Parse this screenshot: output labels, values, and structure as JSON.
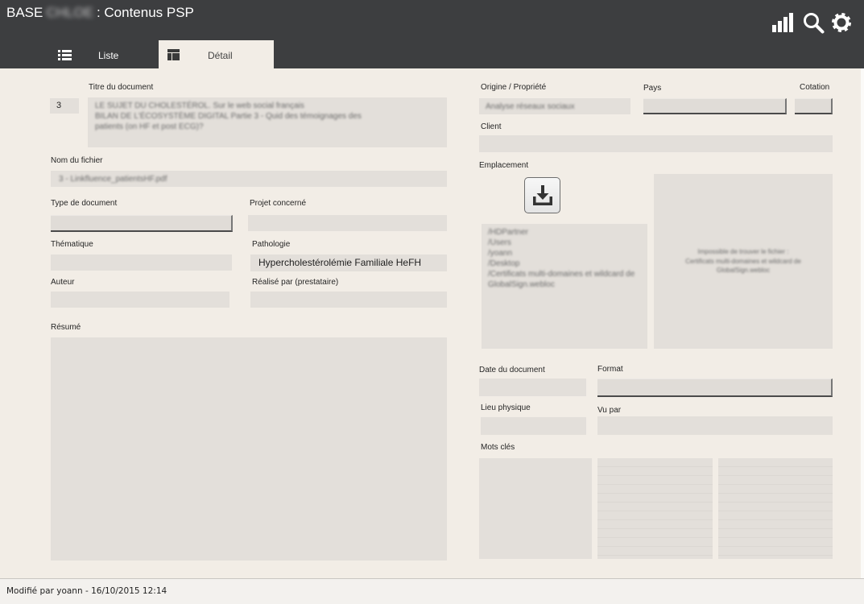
{
  "app": {
    "title_prefix": "BASE",
    "title_redacted": "CHLOE",
    "title_suffix": ": Contenus PSP"
  },
  "header": {
    "icons": [
      "bar-chart-icon",
      "search-icon",
      "gear-icon"
    ]
  },
  "tabs": [
    {
      "label": "Liste",
      "icon": "list-icon",
      "active": false
    },
    {
      "label": "Détail",
      "icon": "layout-icon",
      "active": true
    }
  ],
  "form": {
    "record_number": "3",
    "titre": {
      "label": "Titre du document",
      "value": "LE SUJET DU CHOLESTÉROL. Sur le web social français\nBILAN DE L'ÉCOSYSTÈME DIGITAL Partie 3 - Quid des témoignages des\npatients (on HF et post ECG)?"
    },
    "nom_fichier": {
      "label": "Nom du fichier",
      "value": "3 - Linkfluence_patientsHF.pdf"
    },
    "type_document": {
      "label": "Type de document",
      "value": ""
    },
    "projet": {
      "label": "Projet concerné",
      "value": ""
    },
    "thematique": {
      "label": "Thématique",
      "value": ""
    },
    "pathologie": {
      "label": "Pathologie",
      "value": "Hypercholestérolémie Familiale HeFH"
    },
    "auteur": {
      "label": "Auteur",
      "value": ""
    },
    "realise_par": {
      "label": "Réalisé par (prestataire)",
      "value": ""
    },
    "resume": {
      "label": "Résumé",
      "value": ""
    },
    "origine": {
      "label": "Origine / Propriété",
      "value": "Analyse réseaux sociaux"
    },
    "pays": {
      "label": "Pays",
      "value": ""
    },
    "cotation": {
      "label": "Cotation",
      "value": ""
    },
    "client": {
      "label": "Client",
      "value": ""
    },
    "emplacement": {
      "label": "Emplacement",
      "download_icon": "download-icon",
      "paths": [
        "/HDPartner",
        "/Users",
        "/yoann",
        "/Desktop",
        "/Certificats multi-domaines et wildcard de GlobalSign.webloc"
      ],
      "preview_message": "Impossible de trouver le fichier :\nCertificats multi-domaines et wildcard de GlobalSign.webloc"
    },
    "date_document": {
      "label": "Date du document",
      "value": ""
    },
    "format": {
      "label": "Format",
      "value": ""
    },
    "lieu_physique": {
      "label": "Lieu physique",
      "value": ""
    },
    "vu_par": {
      "label": "Vu par",
      "value": ""
    },
    "mots_cles": {
      "label": "Mots clés",
      "lists": [
        [],
        [],
        []
      ]
    }
  },
  "footer": {
    "status": "Modifié par yoann - 16/10/2015 12:14"
  },
  "colors": {
    "header": "#3d3e40",
    "background": "#f2ede6",
    "field": "#e3dfda",
    "text": "#262626"
  }
}
